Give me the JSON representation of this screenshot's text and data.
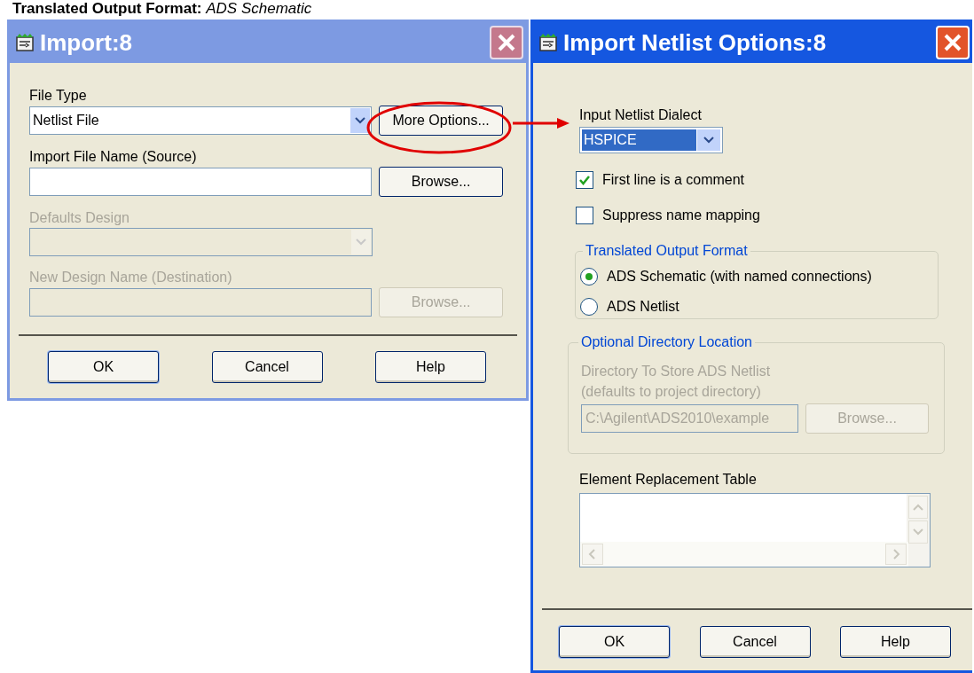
{
  "heading": "**Translated Output Format:** *ADS Schematic*",
  "import_dialog": {
    "title": "Import:8",
    "active": false,
    "fields": [
      {
        "kind": "dropdown",
        "label": "File Type",
        "value": "Netlist File",
        "disabled": false,
        "button": "More Options..."
      },
      {
        "kind": "text",
        "label": "Import File Name (Source)",
        "disabled": false,
        "button": "Browse..."
      },
      {
        "kind": "dropdown",
        "label": "Defaults Design",
        "disabled": true
      },
      {
        "kind": "text",
        "label": "New Design Name (Destination)",
        "disabled": true,
        "button": "Browse..."
      }
    ],
    "buttons": [
      "OK",
      "Cancel",
      "Help"
    ]
  },
  "options_dialog": {
    "title": "Import Netlist Options:8",
    "active": true,
    "dialect": {
      "label": "Input Netlist Dialect",
      "value": "HSPICE"
    },
    "checkboxes": [
      {
        "label": "First line is a comment",
        "checked": true
      },
      {
        "label": "Suppress name mapping",
        "checked": false
      }
    ],
    "output_format": {
      "legend": "Translated Output Format",
      "options": [
        {
          "label": "ADS Schematic (with named connections)",
          "selected": true
        },
        {
          "label": "ADS Netlist",
          "selected": false
        }
      ]
    },
    "directory": {
      "legend": "Optional Directory Location",
      "label": "Directory To Store ADS Netlist\n(defaults to project directory)",
      "value": "C:\\Agilent\\ADS2010\\example",
      "disabled": true,
      "button": "Browse..."
    },
    "table": {
      "label": "Element Replacement Table"
    },
    "buttons": [
      "OK",
      "Cancel",
      "Help"
    ]
  }
}
